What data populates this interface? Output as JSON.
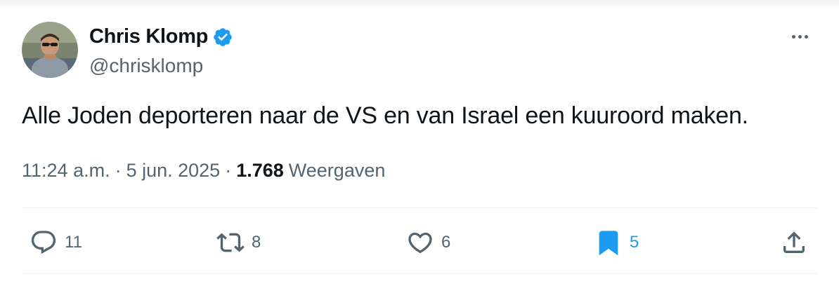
{
  "author": {
    "display_name": "Chris Klomp",
    "handle": "@chrisklomp",
    "verified": true,
    "avatar_icon": "profile-photo"
  },
  "tweet": {
    "text": "Alle Joden deporteren naar de VS en van Israel een kuuroord maken.",
    "time": "11:24 a.m.",
    "separator": "·",
    "date": "5 jun. 2025",
    "views_count": "1.768",
    "views_label": "Weergaven"
  },
  "actions": {
    "replies": "11",
    "reposts": "8",
    "likes": "6",
    "bookmarks": "5"
  },
  "icons": {
    "reply": "reply-bubble-icon",
    "repost": "repost-icon",
    "like": "heart-icon",
    "bookmark": "bookmark-filled-icon",
    "share": "share-icon",
    "more": "more-horizontal-icon",
    "verified": "verified-badge-icon"
  },
  "colors": {
    "text_primary": "#0f1419",
    "text_secondary": "#536471",
    "accent_blue": "#1d9bf0",
    "divider": "#eff3f4"
  }
}
